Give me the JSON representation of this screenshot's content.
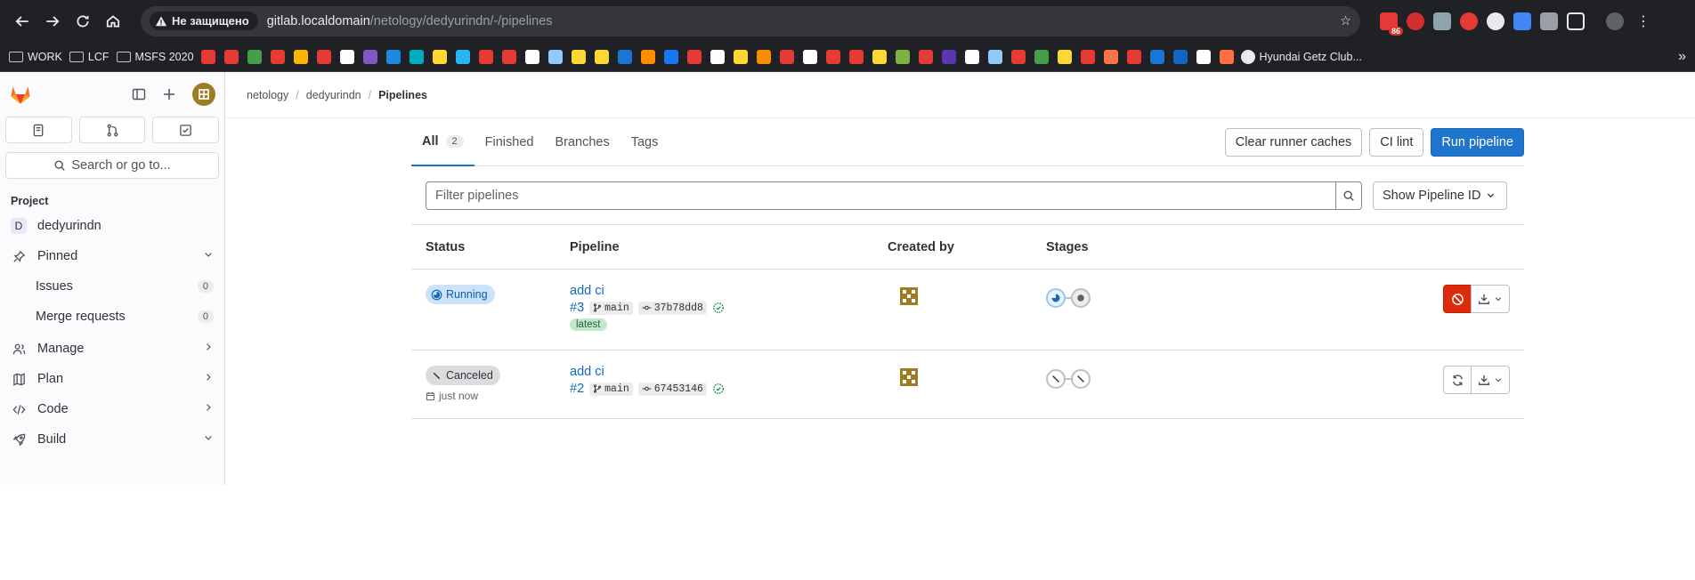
{
  "browser": {
    "security_label": "Не защищено",
    "url_host": "gitlab.localdomain",
    "url_path": "/netology/dedyurindn/-/pipelines",
    "extension_badge": "86",
    "bookmarks": [
      {
        "label": "WORK",
        "type": "folder"
      },
      {
        "label": "LCF",
        "type": "folder"
      },
      {
        "label": "MSFS 2020",
        "type": "folder"
      }
    ],
    "bookmark_last": "Hyundai Getz Club...",
    "bookmark_favicon_colors": [
      "#e53935",
      "#e53935",
      "#43a047",
      "#e53935",
      "#ffb300",
      "#e53935",
      "#ffffff",
      "#7e57c2",
      "#1e88e5",
      "#00acc1",
      "#fdd835",
      "#29b6f6",
      "#e53935",
      "#e53935",
      "#ffffff",
      "#90caf9",
      "#fdd835",
      "#fdd835",
      "#1976d2",
      "#fb8c00",
      "#1877f2",
      "#e53935",
      "#ffffff",
      "#fdd835",
      "#fb8c00",
      "#e53935",
      "#ffffff",
      "#e53935",
      "#e53935",
      "#fdd835",
      "#7cb342",
      "#e53935",
      "#5e35b1",
      "#ffffff",
      "#90caf9",
      "#e53935",
      "#43a047",
      "#fdd835",
      "#e53935",
      "#ff7043",
      "#e53935",
      "#1976d2",
      "#1565c0",
      "#ffffff",
      "#ff7043"
    ]
  },
  "sidebar": {
    "search_label": "Search or go to...",
    "section_title": "Project",
    "project_letter": "D",
    "project_name": "dedyurindn",
    "pinned_label": "Pinned",
    "issues_label": "Issues",
    "issues_count": "0",
    "mr_label": "Merge requests",
    "mr_count": "0",
    "manage_label": "Manage",
    "plan_label": "Plan",
    "code_label": "Code",
    "build_label": "Build"
  },
  "breadcrumb": {
    "group": "netology",
    "project": "dedyurindn",
    "current": "Pipelines"
  },
  "tabs": {
    "all_label": "All",
    "all_count": "2",
    "finished_label": "Finished",
    "branches_label": "Branches",
    "tags_label": "Tags"
  },
  "actions": {
    "clear_caches": "Clear runner caches",
    "ci_lint": "CI lint",
    "run_pipeline": "Run pipeline"
  },
  "filter": {
    "placeholder": "Filter pipelines",
    "select_label": "Show Pipeline ID"
  },
  "table": {
    "headers": {
      "status": "Status",
      "pipeline": "Pipeline",
      "created_by": "Created by",
      "stages": "Stages"
    },
    "rows": [
      {
        "status": "Running",
        "commit_title": "add ci",
        "pipeline_id": "#3",
        "branch": "main",
        "sha": "37b78dd8",
        "tag": "latest"
      },
      {
        "status": "Canceled",
        "time": "just now",
        "commit_title": "add ci",
        "pipeline_id": "#2",
        "branch": "main",
        "sha": "67453146"
      }
    ]
  },
  "colors": {
    "primary": "#1f75cb",
    "danger": "#dd2b0e",
    "running_bg": "#cbe2f9",
    "success": "#108548"
  }
}
